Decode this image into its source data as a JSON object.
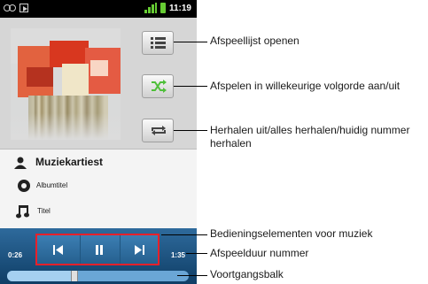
{
  "status_bar": {
    "time": "11:19",
    "icons": [
      "voicemail-icon",
      "media-play-icon",
      "signal-icon",
      "battery-icon"
    ],
    "signal_color": "#66cc33"
  },
  "now_playing": {
    "artist": "Muziekartiest",
    "album": "Albumtitel",
    "track": "Titel",
    "elapsed": "0:26",
    "duration": "1:35",
    "progress_fraction": 0.37
  },
  "side_buttons": [
    {
      "name": "playlist-button",
      "icon": "playlist-icon"
    },
    {
      "name": "shuffle-button",
      "icon": "shuffle-icon",
      "accent": "#4fbf3a"
    },
    {
      "name": "repeat-button",
      "icon": "repeat-icon"
    }
  ],
  "playback_controls": [
    {
      "name": "previous-button",
      "icon": "skip-previous-icon"
    },
    {
      "name": "pause-button",
      "icon": "pause-icon"
    },
    {
      "name": "next-button",
      "icon": "skip-next-icon"
    }
  ],
  "callouts": {
    "playlist": "Afspeellijst openen",
    "shuffle": "Afspelen in willekeurige volgorde aan/uit",
    "repeat": "Herhalen uit/alles herhalen/huidig nummer herhalen",
    "controls": "Bedieningselementen voor muziek",
    "duration": "Afspeelduur nummer",
    "progress": "Voortgangsbalk"
  },
  "colors": {
    "highlight_border": "#e8202a",
    "control_blue": "#2e6a9c"
  }
}
